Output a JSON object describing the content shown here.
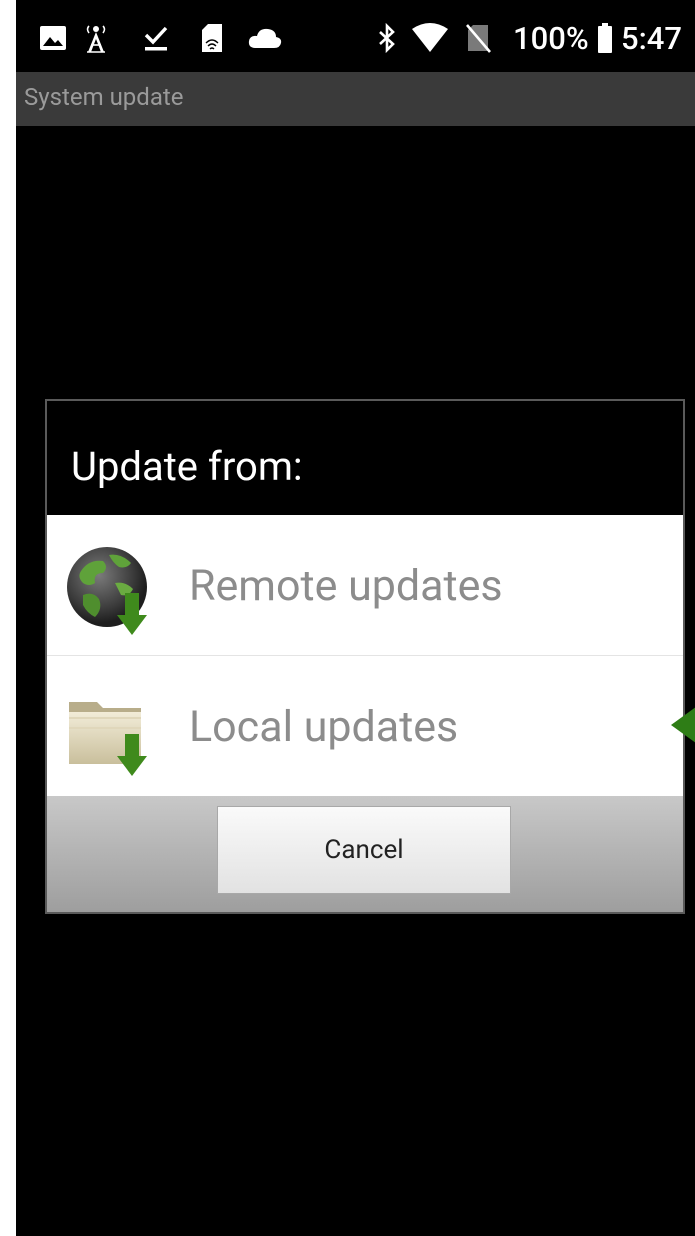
{
  "status_bar": {
    "icons_left": [
      "image-icon",
      "cell-tower-icon",
      "download-done-icon",
      "sd-card-icon",
      "cloud-icon"
    ],
    "icons_right": [
      "bluetooth-icon",
      "wifi-icon",
      "no-sim-icon"
    ],
    "battery_percent": "100%",
    "battery_icon": "battery-full-icon",
    "time": "5:47"
  },
  "app": {
    "title": "System update"
  },
  "dialog": {
    "title": "Update from:",
    "options": [
      {
        "label": "Remote updates",
        "icon": "globe-download-icon"
      },
      {
        "label": "Local updates",
        "icon": "folder-download-icon"
      }
    ],
    "cancel_label": "Cancel"
  },
  "annotation": {
    "arrow_color": "#2e7d16",
    "points_to": "Local updates"
  },
  "colors": {
    "background": "#000000",
    "title_bar": "#3a3a3a",
    "option_text": "#8c8c8c",
    "download_arrow": "#3f8a1c"
  }
}
